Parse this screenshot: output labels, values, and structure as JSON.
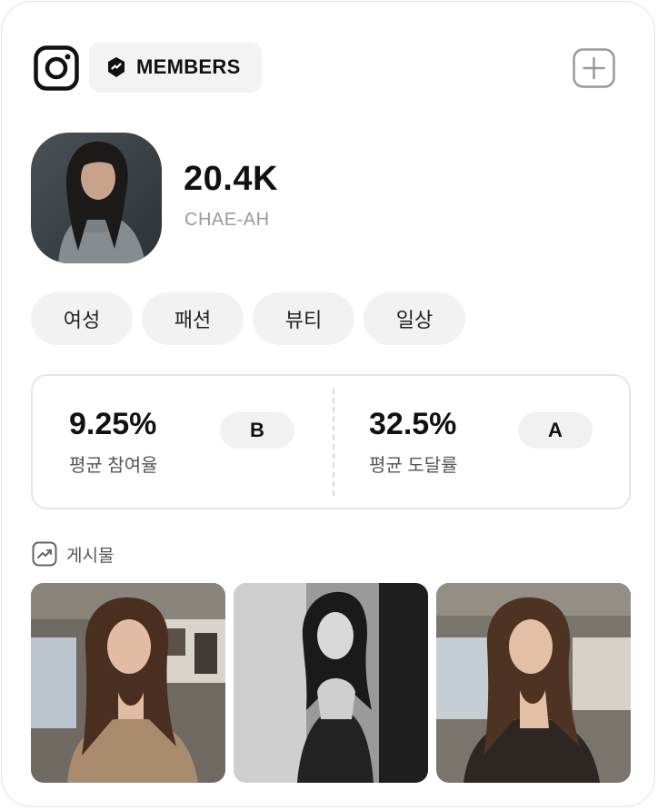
{
  "header": {
    "platform_icon": "instagram-icon",
    "badge": {
      "icon": "verified-shield-icon",
      "label": "MEMBERS"
    },
    "add_icon": "plus-square-icon"
  },
  "profile": {
    "followers": "20.4K",
    "username": "CHAE-AH"
  },
  "tags": [
    "여성",
    "패션",
    "뷰티",
    "일상"
  ],
  "stats": [
    {
      "value": "9.25%",
      "label": "평균 참여율",
      "grade": "B"
    },
    {
      "value": "32.5%",
      "label": "평균 도달률",
      "grade": "A"
    }
  ],
  "posts": {
    "icon": "trending-up-icon",
    "label": "게시물",
    "items": [
      {
        "type": "photo",
        "tone": "warm-color"
      },
      {
        "type": "photo",
        "tone": "black-and-white"
      },
      {
        "type": "photo",
        "tone": "warm-color"
      }
    ]
  },
  "colors": {
    "background": "#ffffff",
    "chip": "#f2f2f2",
    "border": "#e6e6e6",
    "text_primary": "#111111",
    "text_muted": "#9a9a9a"
  }
}
